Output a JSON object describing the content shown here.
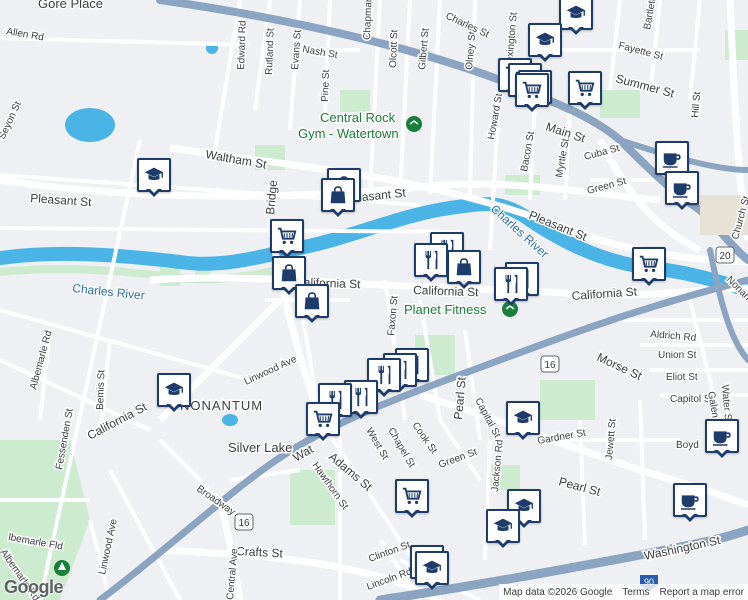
{
  "labels": {
    "places": [
      "Gore Place",
      "NONANTUM",
      "Silver Lake"
    ],
    "water": [
      "Charles River",
      "Charles River"
    ],
    "pois": [
      "Central Rock",
      "Gym - Watertown",
      "Planet Fitness"
    ],
    "roads": {
      "allen_rd": "Allen Rd",
      "seyon_st": "Seyon St",
      "edward_rd": "Edward Rd",
      "rutland_st": "Rutland St",
      "evans_st": "Evans St",
      "nash_st": "Nash St",
      "pine_st": "Pine St",
      "waltham_st": "Waltham St",
      "pleasant_st_w": "Pleasant St",
      "pleasant_st_c": "Pleasant St",
      "pleasant_st_e": "Pleasant St",
      "bridge_st": "Bridge",
      "california_st_w": "California St",
      "california_st_c": "California St",
      "california_st_e": "California St",
      "california_st_sw": "California St",
      "linwood_ave": "Linwood Ave",
      "albemarle_rd": "Albemarle Rd",
      "bemis_st": "Bemis St",
      "fessenden_st": "Fessenden St",
      "adams_st": "Adams St",
      "watertown_st": "Wat",
      "hawthorn_st": "Hawthorn St",
      "broadway": "Broadway",
      "linwood_ave_s": "Linwood Ave",
      "crafts_st": "Crafts St",
      "central_ave": "Central Ave",
      "west_st": "West St",
      "chapel_st": "Chapel St",
      "cook_st": "Cook St",
      "green_st": "Green St",
      "pearl_st": "Pearl St",
      "pearl_st_e": "Pearl St",
      "capital_st": "Capital St",
      "jackson_rd": "Jackson Rd",
      "clinton_st": "Clinton St",
      "lincoln_rd": "Lincoln Rd",
      "faxon_st": "Faxon St",
      "main_st": "Main St",
      "summer_st": "Summer St",
      "fayette_st": "Fayette St",
      "howard_st": "Howard St",
      "bacon_st": "Bacon St",
      "myrtle_st": "Myrtle St",
      "cuba_st": "Cuba St",
      "green_st_n": "Green St",
      "olcott_st": "Olcott St",
      "gilbert_st": "Gilbert St",
      "olney_st": "Olney St",
      "charles_st": "Charles St",
      "lexington_st": "Lexington St",
      "chapman_st": "Chapman",
      "aldrich_rd": "Aldrich Rd",
      "union_st": "Union St",
      "eliot_st": "Eliot St",
      "capitol_st": "Capitol St",
      "morse_st": "Morse St",
      "galen_st": "Galen St",
      "water_st": "Water St",
      "jewett_st": "Jewett St",
      "gardner_st": "Gardner St",
      "boyd": "Boyd",
      "washington_st": "Washington St",
      "church_st": "Church St",
      "nonantum": "Nonantum",
      "hill_st": "Hill St",
      "bartlett_st": "Bartlett St",
      "route16_a": "16",
      "route16_b": "16",
      "route20": "20",
      "route90": "90",
      "albemarle_fld": "lbemarle Fld",
      "albemarle_rd_s": "Albemarle Rd",
      "pearl_label_w": "Pearl St"
    }
  },
  "markers": [
    {
      "icon": "school-icon"
    },
    {
      "icon": "school-icon"
    },
    {
      "icon": "grocery-cart-icon"
    },
    {
      "icon": "grocery-cart-icon"
    },
    {
      "icon": "grocery-cart-icon"
    },
    {
      "icon": "grocery-cart-icon"
    },
    {
      "icon": "grocery-cart-icon"
    },
    {
      "icon": "coffee-cup-icon"
    },
    {
      "icon": "coffee-cup-icon"
    },
    {
      "icon": "school-icon"
    },
    {
      "icon": "shopping-bag-icon"
    },
    {
      "icon": "shopping-bag-icon"
    },
    {
      "icon": "grocery-cart-icon"
    },
    {
      "icon": "shopping-bag-icon"
    },
    {
      "icon": "shopping-bag-icon"
    },
    {
      "icon": "restaurant-icon"
    },
    {
      "icon": "shopping-bag-icon"
    },
    {
      "icon": "restaurant-icon"
    },
    {
      "icon": "grocery-cart-icon"
    },
    {
      "icon": "school-icon"
    },
    {
      "icon": "restaurant-icon"
    },
    {
      "icon": "restaurant-icon"
    },
    {
      "icon": "restaurant-icon"
    },
    {
      "icon": "grocery-cart-icon"
    },
    {
      "icon": "school-icon"
    },
    {
      "icon": "coffee-cup-icon"
    },
    {
      "icon": "grocery-cart-icon"
    },
    {
      "icon": "school-icon"
    },
    {
      "icon": "coffee-cup-icon"
    },
    {
      "icon": "school-icon"
    },
    {
      "icon": "school-icon"
    },
    {
      "icon": "coffee-cup-icon"
    }
  ],
  "attribution": {
    "logo": "Google",
    "map_data": "Map data ©2026 Google",
    "terms": "Terms",
    "report": "Report a map error"
  },
  "colors": {
    "land": "#eef0f3",
    "water": "#4ab4e6",
    "park": "#cdeccf",
    "highway": "#8aa4c2",
    "marker_border": "#1d3c6b"
  }
}
